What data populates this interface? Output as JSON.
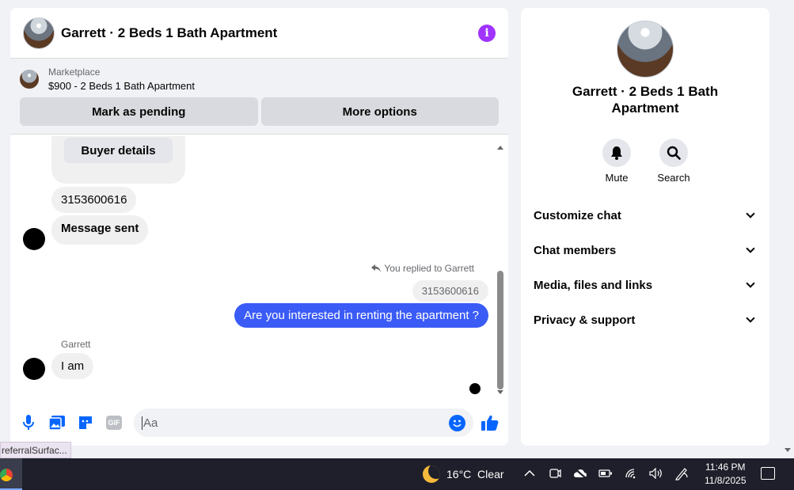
{
  "chat": {
    "title": "Garrett · 2 Beds 1 Bath Apartment",
    "info_icon": "info-icon",
    "marketplace": {
      "label": "Marketplace",
      "listing": "$900 - 2 Beds 1 Bath Apartment",
      "mark_pending": "Mark as pending",
      "more_options": "More options"
    },
    "messages": {
      "buyer_details": "Buyer details",
      "phone_incoming": "3153600616",
      "message_sent": "Message sent",
      "reply_note": "You replied to Garrett",
      "reply_quote": "3153600616",
      "outgoing": "Are you interested in renting the apartment ?",
      "sender": "Garrett",
      "incoming_reply": "I am"
    },
    "composer": {
      "placeholder": "Aa",
      "gif_label": "GIF",
      "icons": [
        "microphone-icon",
        "photo-icon",
        "sticker-icon",
        "gif-icon",
        "emoji-icon",
        "thumbs-up-icon"
      ]
    }
  },
  "side": {
    "title": "Garrett · 2 Beds 1 Bath Apartment",
    "actions": [
      {
        "label": "Mute",
        "icon": "bell-icon"
      },
      {
        "label": "Search",
        "icon": "search-icon"
      }
    ],
    "menu": [
      "Customize chat",
      "Chat members",
      "Media, files and links",
      "Privacy & support"
    ]
  },
  "status_tip": "referralSurfac...",
  "taskbar": {
    "weather": "16°C  Clear",
    "time": "11:46 PM",
    "date": "11/8/2025"
  },
  "colors": {
    "accent": "#3b5bf6",
    "info": "#a033ff",
    "icon_blue": "#0866ff"
  }
}
